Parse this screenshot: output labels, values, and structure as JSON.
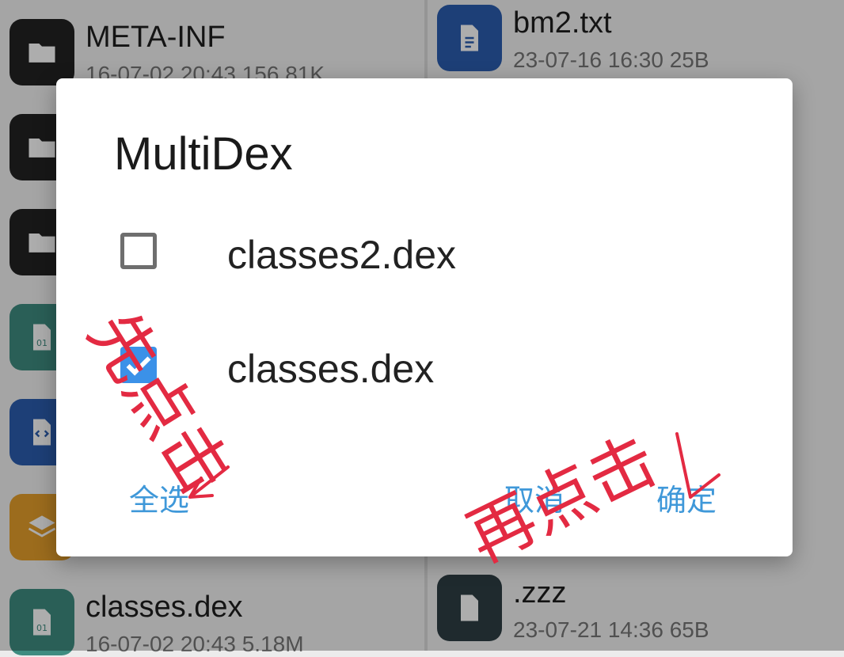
{
  "left_pane": {
    "items": [
      {
        "name": "META-INF",
        "meta": "16-07-02 20:43  156.81K",
        "icon": "folder-icon"
      },
      {
        "name": "",
        "meta": "",
        "icon": "folder-icon"
      },
      {
        "name": "",
        "meta": "",
        "icon": "folder-icon"
      },
      {
        "name": "",
        "meta": "",
        "icon": "binary-file-icon"
      },
      {
        "name": "",
        "meta": "",
        "icon": "code-file-icon"
      },
      {
        "name": "",
        "meta": "",
        "icon": "layers-icon"
      },
      {
        "name": "classes.dex",
        "meta": "16-07-02 20:43  5.18M",
        "icon": "binary-file-icon"
      }
    ]
  },
  "right_pane": {
    "items": [
      {
        "name": "bm2.txt",
        "meta": "23-07-16 16:30  25B",
        "icon": "text-file-icon"
      },
      {
        "name": ".zzz",
        "meta": "23-07-21 14:36  65B",
        "icon": "file-icon"
      }
    ]
  },
  "dialog": {
    "title": "MultiDex",
    "options": [
      {
        "label": "classes2.dex",
        "checked": false
      },
      {
        "label": "classes.dex",
        "checked": true
      }
    ],
    "select_all_label": "全选",
    "cancel_label": "取消",
    "ok_label": "确定",
    "accent_color": "#3b91e8"
  },
  "annotations": {
    "first_click": "先点击",
    "then_click": "再点击",
    "color": "#e32a42"
  },
  "colors": {
    "folder_icon_bg": "#232323",
    "binary_icon_bg": "#3e8c80",
    "code_icon_bg": "#2b5eb0",
    "layers_icon_bg": "#e6a02c",
    "text_icon_bg": "#2b5eb0",
    "generic_icon_bg": "#2e3e44"
  }
}
